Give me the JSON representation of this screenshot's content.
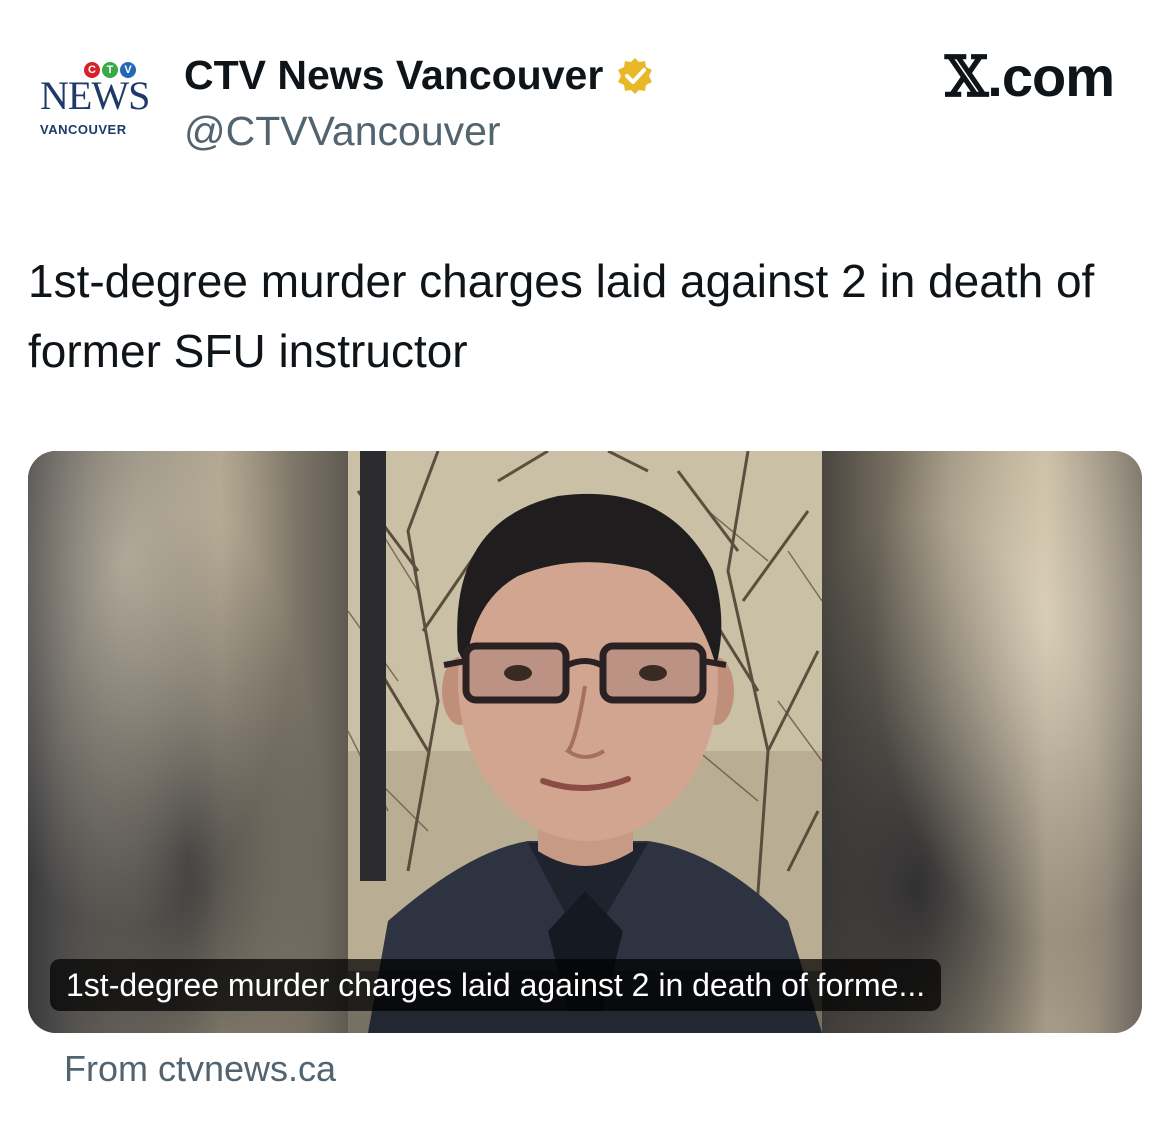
{
  "account": {
    "avatar_top": "CTV",
    "avatar_name": "NEWS",
    "avatar_sub": "VANCOUVER",
    "name": "CTV News Vancouver",
    "handle": "@CTVVancouver",
    "verified_icon": "gold-verified-badge"
  },
  "platform": {
    "label_x": "𝕏",
    "label_suffix": ".com"
  },
  "tweet": {
    "text": "1st-degree murder charges laid against 2 in death of former SFU instructor"
  },
  "card": {
    "caption": "1st-degree murder charges laid against 2 in death of forme...",
    "source": "From ctvnews.ca"
  },
  "colors": {
    "text_primary": "#0f1419",
    "text_secondary": "#536471",
    "ctv_red": "#d6222b",
    "ctv_green": "#3aa845",
    "ctv_blue": "#2368b8",
    "news_blue": "#1f3a6a",
    "verified_gold": "#e8b829"
  }
}
